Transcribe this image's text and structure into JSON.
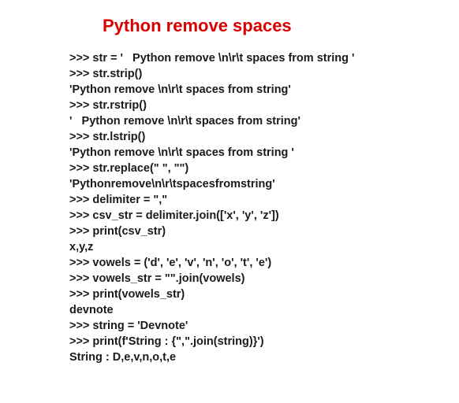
{
  "title": "Python remove spaces",
  "lines": [
    ">>> str = '   Python remove \\n\\r\\t spaces from string '",
    ">>> str.strip()",
    "'Python remove \\n\\r\\t spaces from string'",
    ">>> str.rstrip()",
    "'   Python remove \\n\\r\\t spaces from string'",
    ">>> str.lstrip()",
    "'Python remove \\n\\r\\t spaces from string '",
    ">>> str.replace(\" \", \"\")",
    "'Pythonremove\\n\\r\\tspacesfromstring'",
    ">>> delimiter = \",\"",
    ">>> csv_str = delimiter.join(['x', 'y', 'z'])",
    ">>> print(csv_str)",
    "x,y,z",
    ">>> vowels = ('d', 'e', 'v', 'n', 'o', 't', 'e')",
    ">>> vowels_str = \"\".join(vowels)",
    ">>> print(vowels_str)",
    "devnote",
    ">>> string = 'Devnote'",
    ">>> print(f'String : {\",\".join(string)}')",
    "String : D,e,v,n,o,t,e"
  ]
}
